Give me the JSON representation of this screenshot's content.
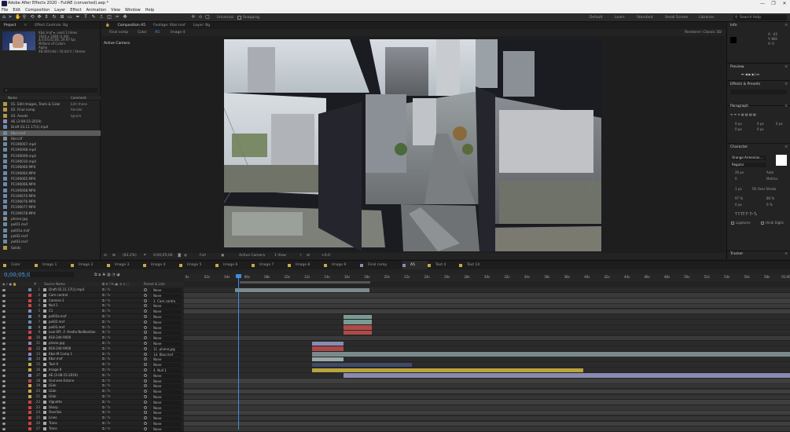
{
  "window": {
    "title": "Adobe After Effects 2020 - FullAE (converted).aep *",
    "controls": [
      "—",
      "❐",
      "✕"
    ]
  },
  "menu": [
    "File",
    "Edit",
    "Composition",
    "Layer",
    "Effect",
    "Animation",
    "View",
    "Window",
    "Help"
  ],
  "toolbar": {
    "universal": "Universal",
    "snapping": "Snapping",
    "workspaces": [
      "Default",
      "Learn",
      "Standard",
      "Small Screen",
      "Libraries"
    ],
    "search_placeholder": "Search Help"
  },
  "project": {
    "tabs": [
      "Project",
      "Effect Controls: Bg"
    ],
    "info": [
      "Kbsr.mxf ▾, used 3 times",
      "1920 x 1080 (1.00)",
      "Δ 0;05;01;06, 29.97 fps",
      "Millions of Colors",
      "Alpha",
      "48.000 kHz / 16 bit U / Stereo"
    ],
    "search_placeholder": "⌕",
    "col_name": "Name",
    "col_comment": "Comment",
    "items": [
      {
        "name": "01. Edit Images, Texts & Color",
        "extra": "Edit these",
        "type": "folder"
      },
      {
        "name": "02. Final comp",
        "extra": "Render",
        "type": "folder"
      },
      {
        "name": "03. Assets",
        "extra": "Ignore",
        "type": "folder"
      },
      {
        "name": "AE (3-08-15-2019)",
        "extra": "",
        "type": "comp"
      },
      {
        "name": "Draft 03.11.17(1).mp4",
        "extra": "",
        "type": "video"
      },
      {
        "name": "Kbsr.mxf",
        "extra": "",
        "type": "video",
        "selected": true
      },
      {
        "name": "Kbsr.tif",
        "extra": "",
        "type": "file"
      },
      {
        "name": "P1190007.mp4",
        "extra": "",
        "type": "video"
      },
      {
        "name": "P1190008.mp4",
        "extra": "",
        "type": "video"
      },
      {
        "name": "P1190009.mp4",
        "extra": "",
        "type": "video"
      },
      {
        "name": "P1190010.mp4",
        "extra": "",
        "type": "video"
      },
      {
        "name": "P1190060.MP4",
        "extra": "",
        "type": "video"
      },
      {
        "name": "P1190064.MP4",
        "extra": "",
        "type": "video"
      },
      {
        "name": "P1190065.MP4",
        "extra": "",
        "type": "video"
      },
      {
        "name": "P1190066.MP4",
        "extra": "",
        "type": "video"
      },
      {
        "name": "P1190068.MP4",
        "extra": "",
        "type": "video"
      },
      {
        "name": "P1190070.MP4",
        "extra": "",
        "type": "video"
      },
      {
        "name": "P1190076.MP4",
        "extra": "",
        "type": "video"
      },
      {
        "name": "P1190077.MP4",
        "extra": "",
        "type": "video"
      },
      {
        "name": "P1190078.MP4",
        "extra": "",
        "type": "video"
      },
      {
        "name": "phone.jpg",
        "extra": "",
        "type": "file"
      },
      {
        "name": "pol01.mxf",
        "extra": "",
        "type": "video"
      },
      {
        "name": "pol01a.mxf",
        "extra": "",
        "type": "video"
      },
      {
        "name": "pol02.mxf",
        "extra": "",
        "type": "video"
      },
      {
        "name": "pol03.mxf",
        "extra": "",
        "type": "video"
      },
      {
        "name": "Solids",
        "extra": "",
        "type": "folder"
      }
    ],
    "footer": "8 bpc"
  },
  "composition": {
    "tab": "Composition A5",
    "footage_tab": "Footage: Kbsr.mxf",
    "layer_tab": "Layer: Bg",
    "sub_items": [
      "Final comp",
      "Color",
      "A5",
      "Image 4"
    ],
    "renderer": "Renderer: Classic 3D",
    "active_camera": "Active Camera",
    "bottom": {
      "zoom": "(63.2%)",
      "timecode": "0;00;05;06",
      "quality": "Full",
      "camera": "Active Camera",
      "views": "1 View",
      "offset": "+0.0"
    }
  },
  "right": {
    "info": "Info",
    "info_vals": [
      "X: -43",
      "Y: 881",
      "A: 0"
    ],
    "preview": "Preview",
    "effects": "Effects & Presets",
    "paragraph": "Paragraph",
    "para_vals": [
      "0 px",
      "0 px",
      "0 px",
      "0 px",
      "0 px"
    ],
    "character": "Character",
    "font": "Orange Armenian...",
    "style": "Regular",
    "char_vals": [
      "26 px",
      "Auto",
      "0",
      "Metrics",
      "1 px",
      "Fill Over Stroke",
      "97 %",
      "86 %",
      "0 px",
      "0 %"
    ],
    "ligatures": "Ligatures",
    "hindi": "Hindi Digits",
    "tracker": "Tracker"
  },
  "timeline": {
    "tabs": [
      "Color",
      "Image 1",
      "Image 2",
      "Image 3",
      "Image 4",
      "Image 5",
      "Image 6",
      "Image 7",
      "Image 8",
      "Image 9",
      "Final comp",
      "A5",
      "Text 4",
      "Text 14"
    ],
    "active_tab": "A5",
    "tab_colors": [
      "#c9a84a",
      "#c9a84a",
      "#c9a84a",
      "#c9a84a",
      "#c9a84a",
      "#c9a84a",
      "#c9a84a",
      "#c9a84a",
      "#c9a84a",
      "#c9a84a",
      "#8a8ab8",
      "#8a8ab8",
      "#c9a84a",
      "#c9a84a"
    ],
    "timecode": "0;00;05;06",
    "ruler": [
      "0s",
      "02s",
      "04s",
      "06s",
      "08s",
      "10s",
      "12s",
      "14s",
      "16s",
      "18s",
      "20s",
      "22s",
      "24s",
      "26s",
      "28s",
      "30s",
      "32s",
      "34s",
      "36s",
      "38s",
      "40s",
      "42s",
      "44s",
      "46s",
      "48s",
      "50s",
      "52s",
      "54s",
      "56s",
      "58s",
      "01;00s"
    ],
    "cols": {
      "source": "Source Name",
      "parent": "Parent & Link"
    },
    "layers": [
      {
        "n": "1",
        "name": "Draft 03.11.17(1).mp4",
        "label": "#6a8aa8",
        "parent": "None",
        "bar": [
          65,
          236
        ],
        "color": "#7a8a8c"
      },
      {
        "n": "2",
        "name": "Cam control",
        "label": "#c44",
        "parent": "None",
        "bar": [
          0,
          771
        ],
        "color": "#3a3a3a"
      },
      {
        "n": "3",
        "name": "Camera 1",
        "label": "#c44",
        "parent": "2. Cam contro",
        "bar": [
          0,
          771
        ],
        "color": "#3f3f3f"
      },
      {
        "n": "4",
        "name": "Null 1",
        "label": "#c44",
        "parent": "None",
        "bar": [
          0,
          771
        ],
        "color": "#3a3a3a"
      },
      {
        "n": "5",
        "name": "C1",
        "label": "#8a8ab8",
        "parent": "None",
        "bar": [
          0,
          771
        ],
        "color": "#3f3f3f"
      },
      {
        "n": "6",
        "name": "pol03a.mxf",
        "label": "#6a8aa8",
        "parent": "None",
        "bar": [
          203,
          239
        ],
        "color": "#7a9a94"
      },
      {
        "n": "7",
        "name": "pol02.mxf",
        "label": "#6a8aa8",
        "parent": "None",
        "bar": [
          203,
          239
        ],
        "color": "#7a9a94"
      },
      {
        "n": "8",
        "name": "pol03.mxf",
        "label": "#6a8aa8",
        "parent": "None",
        "bar": [
          203,
          239
        ],
        "color": "#b04a48"
      },
      {
        "n": "9",
        "name": "Low Off...F. Aredio Nailbostian",
        "label": "#c44",
        "parent": "None",
        "bar": [
          203,
          239
        ],
        "color": "#b04a48"
      },
      {
        "n": "10",
        "name": "818-244-9000",
        "label": "#c44",
        "parent": "None",
        "bar": [
          0,
          771
        ],
        "color": "#3a3a3a"
      },
      {
        "n": "11",
        "name": "phone.jpg",
        "label": "#8a8ab8",
        "parent": "None",
        "bar": [
          163,
          203
        ],
        "color": "#8a8ab0"
      },
      {
        "n": "12",
        "name": "818-244-9000",
        "label": "#c44",
        "parent": "11. phone.jpg",
        "bar": [
          163,
          203
        ],
        "color": "#a84848"
      },
      {
        "n": "13",
        "name": "Kbsr.M Comp 1",
        "label": "#8a8ab8",
        "parent": "14. Kbsr.mxf",
        "bar": [
          163,
          771
        ],
        "color": "#7a8a8c"
      },
      {
        "n": "14",
        "name": "Kbsr.mxf",
        "label": "#6a8aa8",
        "parent": "None",
        "bar": [
          163,
          203
        ],
        "color": "#9aa8a4"
      },
      {
        "n": "15",
        "name": "Text 9",
        "label": "#c9a84a",
        "parent": "None",
        "bar": [
          163,
          290
        ],
        "color": "#3d4a6a"
      },
      {
        "n": "16",
        "name": "Image 9",
        "label": "#c9a84a",
        "parent": "4. Null 1",
        "bar": [
          163,
          508
        ],
        "color": "#b8a43a"
      },
      {
        "n": "17",
        "name": "AE (3-08-15-2019)",
        "label": "#8a8ab8",
        "parent": "None",
        "bar": [
          203,
          771
        ],
        "color": "#8a8ab0"
      },
      {
        "n": "18",
        "name": "Grunnee Estone",
        "label": "#c44",
        "parent": "None",
        "bar": [
          0,
          771
        ],
        "color": "#3f3f3f"
      },
      {
        "n": "19",
        "name": "LEak",
        "label": "#c9a84a",
        "parent": "None",
        "bar": [
          0,
          771
        ],
        "color": "#353535"
      },
      {
        "n": "20",
        "name": "LEak",
        "label": "#c9a84a",
        "parent": "None",
        "bar": [
          0,
          771
        ],
        "color": "#3f3f3f"
      },
      {
        "n": "21",
        "name": "LEak",
        "label": "#c9a84a",
        "parent": "None",
        "bar": [
          0,
          771
        ],
        "color": "#353535"
      },
      {
        "n": "22",
        "name": "Vignette",
        "label": "#c44",
        "parent": "None",
        "bar": [
          0,
          771
        ],
        "color": "#3f3f3f"
      },
      {
        "n": "23",
        "name": "Sharp",
        "label": "#c44",
        "parent": "None",
        "bar": [
          0,
          771
        ],
        "color": "#353535"
      },
      {
        "n": "24",
        "name": "Overlies",
        "label": "#c44",
        "parent": "None",
        "bar": [
          0,
          771
        ],
        "color": "#3f3f3f"
      },
      {
        "n": "25",
        "name": "Lines",
        "label": "#c44",
        "parent": "None",
        "bar": [
          0,
          771
        ],
        "color": "#353535"
      },
      {
        "n": "26",
        "name": "Trans",
        "label": "#c44",
        "parent": "None",
        "bar": [
          0,
          771
        ],
        "color": "#3f3f3f"
      },
      {
        "n": "27",
        "name": "Trans",
        "label": "#c44",
        "parent": "None",
        "bar": [
          0,
          771
        ],
        "color": "#353535"
      }
    ]
  }
}
